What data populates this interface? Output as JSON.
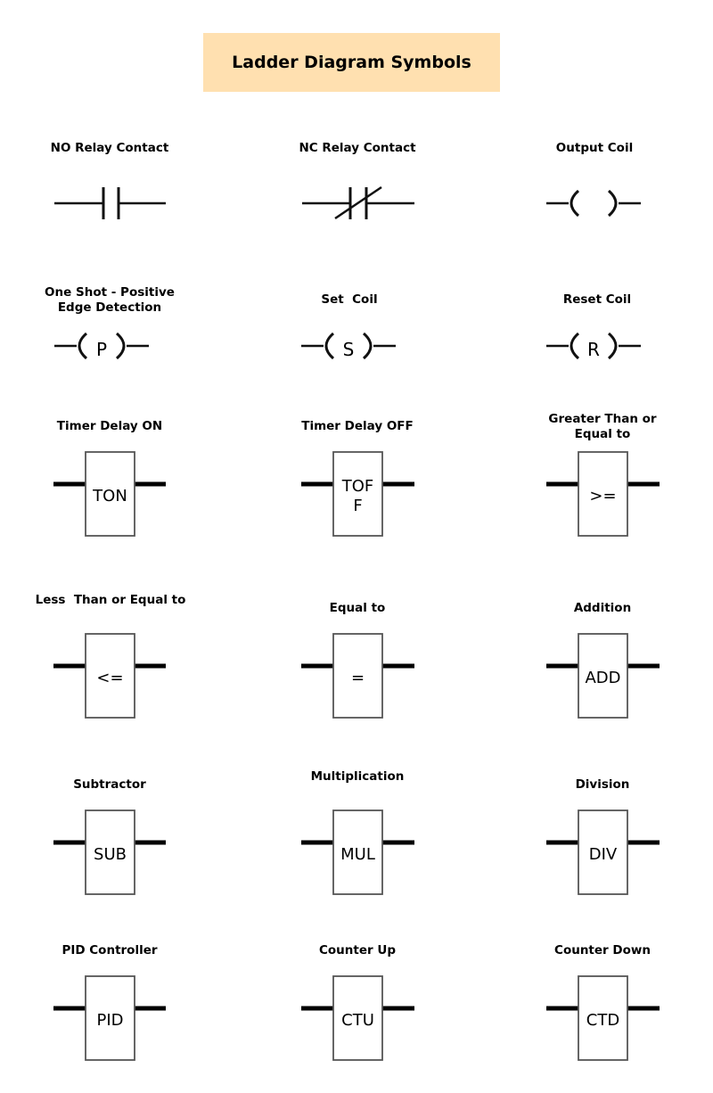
{
  "title": "Ladder Diagram Symbols",
  "colors": {
    "title_background": "#FFE0B0",
    "line": "#000000",
    "box_border": "#555555"
  },
  "symbols": [
    {
      "name": "NO Relay Contact",
      "kind": "no-contact",
      "text": ""
    },
    {
      "name": "NC Relay Contact",
      "kind": "nc-contact",
      "text": ""
    },
    {
      "name": "Output Coil",
      "kind": "coil",
      "text": ""
    },
    {
      "name": "One Shot - Positive Edge Detection",
      "kind": "coil",
      "text": "P"
    },
    {
      "name": "Set  Coil",
      "kind": "coil",
      "text": "S"
    },
    {
      "name": "Reset Coil",
      "kind": "coil",
      "text": "R"
    },
    {
      "name": "Timer Delay ON",
      "kind": "block",
      "text": "TON"
    },
    {
      "name": "Timer Delay OFF",
      "kind": "block",
      "text": "TOF\nF"
    },
    {
      "name": "Greater Than or Equal to",
      "kind": "block",
      "text": ">="
    },
    {
      "name": "Less  Than or Equal to",
      "kind": "block",
      "text": "<="
    },
    {
      "name": "Equal to",
      "kind": "block",
      "text": "="
    },
    {
      "name": "Addition",
      "kind": "block",
      "text": "ADD"
    },
    {
      "name": "Subtractor",
      "kind": "block",
      "text": "SUB"
    },
    {
      "name": "Multiplication",
      "kind": "block",
      "text": "MUL"
    },
    {
      "name": "Division",
      "kind": "block",
      "text": "DIV"
    },
    {
      "name": "PID Controller",
      "kind": "block",
      "text": "PID"
    },
    {
      "name": "Counter Up",
      "kind": "block",
      "text": "CTU"
    },
    {
      "name": "Counter Down",
      "kind": "block",
      "text": "CTD"
    }
  ]
}
